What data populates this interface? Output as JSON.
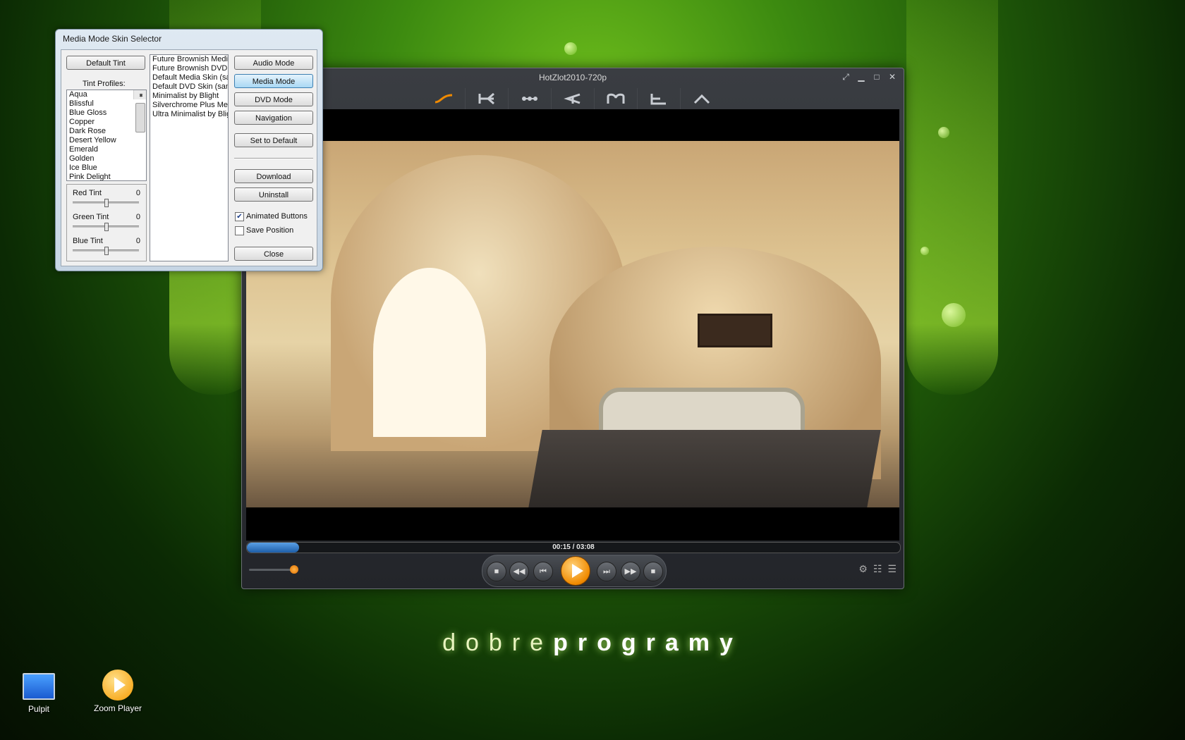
{
  "dialog": {
    "title": "Media Mode Skin Selector",
    "default_tint_label": "Default Tint",
    "tint_profiles_label": "Tint Profiles:",
    "tint_profiles": [
      "Aqua",
      "Blissful",
      "Blue Gloss",
      "Copper",
      "Dark Rose",
      "Desert Yellow",
      "Emerald",
      "Golden",
      "Ice Blue",
      "Pink Delight"
    ],
    "skins": [
      "Future Brownish Media",
      "Future Brownish DVD S",
      "Default Media Skin (sa",
      "Default DVD Skin (sam",
      "Minimalist by Blight",
      "Silverchrome Plus Mec",
      "Ultra Minimalist by Bligh"
    ],
    "tints": [
      {
        "label": "Red Tint",
        "value": "0"
      },
      {
        "label": "Green Tint",
        "value": "0"
      },
      {
        "label": "Blue Tint",
        "value": "0"
      }
    ],
    "buttons": {
      "audio_mode": "Audio Mode",
      "media_mode": "Media Mode",
      "dvd_mode": "DVD Mode",
      "navigation": "Navigation",
      "set_default": "Set to Default",
      "download": "Download",
      "uninstall": "Uninstall",
      "close": "Close"
    },
    "checkboxes": {
      "animated_buttons": {
        "label": "Animated Buttons",
        "checked": true
      },
      "save_position": {
        "label": "Save Position",
        "checked": false
      }
    }
  },
  "player": {
    "title": "HotZlot2010-720p",
    "time": "00:15 / 03:08",
    "progress": 0.08,
    "volume": 0.9,
    "accent": "#f08a00"
  },
  "brand": {
    "light": "dobre",
    "bold": "programy"
  },
  "desktop_icons": [
    {
      "label": "Pulpit",
      "icon": "monitor-icon"
    },
    {
      "label": "Zoom Player",
      "icon": "zoom-player-icon"
    }
  ]
}
